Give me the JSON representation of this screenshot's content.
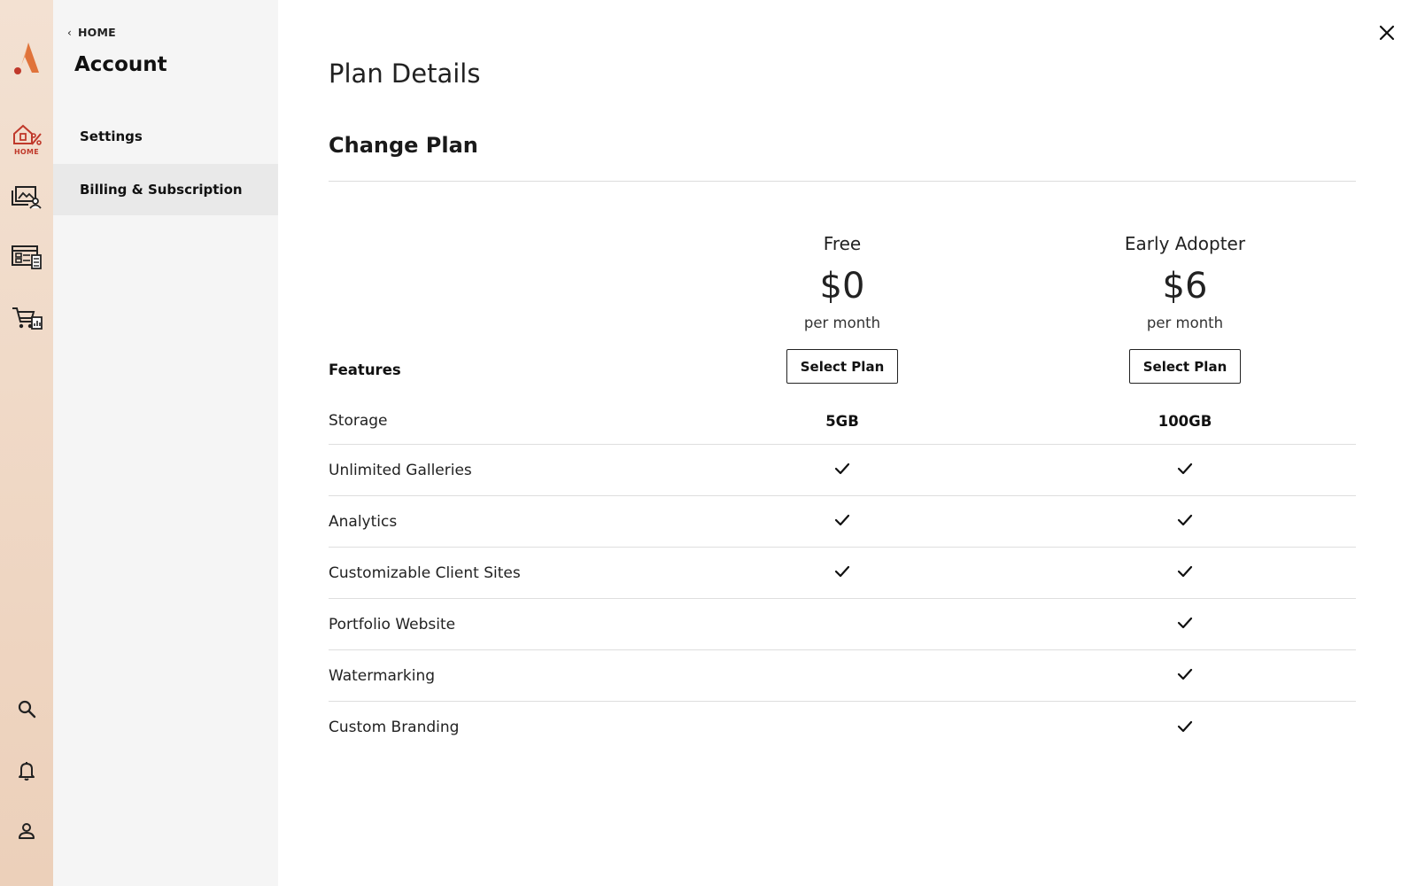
{
  "rail": {
    "items": [
      {
        "icon": "home-percent-icon",
        "label": "HOME",
        "active": true
      },
      {
        "icon": "gallery-user-icon",
        "label": ""
      },
      {
        "icon": "website-builder-icon",
        "label": ""
      },
      {
        "icon": "store-chart-icon",
        "label": ""
      },
      {
        "icon": "search-icon",
        "label": ""
      },
      {
        "icon": "bell-icon",
        "label": ""
      },
      {
        "icon": "user-icon",
        "label": ""
      }
    ],
    "accent": "#c0392b",
    "logo_color": "#e0733a"
  },
  "subnav": {
    "back_chevron": "‹",
    "back_label": "HOME",
    "title": "Account",
    "items": [
      {
        "label": "Settings",
        "active": false
      },
      {
        "label": "Billing & Subscription",
        "active": true
      }
    ]
  },
  "main": {
    "page_title": "Plan Details",
    "section_title": "Change Plan",
    "features_label": "Features",
    "plans": [
      {
        "name": "Free",
        "price": "$0",
        "period": "per month",
        "button": "Select Plan"
      },
      {
        "name": "Early Adopter",
        "price": "$6",
        "period": "per month",
        "button": "Select Plan"
      }
    ],
    "features": [
      {
        "name": "Storage",
        "values": [
          "5GB",
          "100GB"
        ]
      },
      {
        "name": "Unlimited Galleries",
        "values": [
          true,
          true
        ]
      },
      {
        "name": "Analytics",
        "values": [
          true,
          true
        ]
      },
      {
        "name": "Customizable Client Sites",
        "values": [
          true,
          true
        ]
      },
      {
        "name": "Portfolio Website",
        "values": [
          false,
          true
        ]
      },
      {
        "name": "Watermarking",
        "values": [
          false,
          true
        ]
      },
      {
        "name": "Custom Branding",
        "values": [
          false,
          true
        ]
      }
    ]
  },
  "icons": {
    "close": "close-icon",
    "check": "check-icon"
  }
}
